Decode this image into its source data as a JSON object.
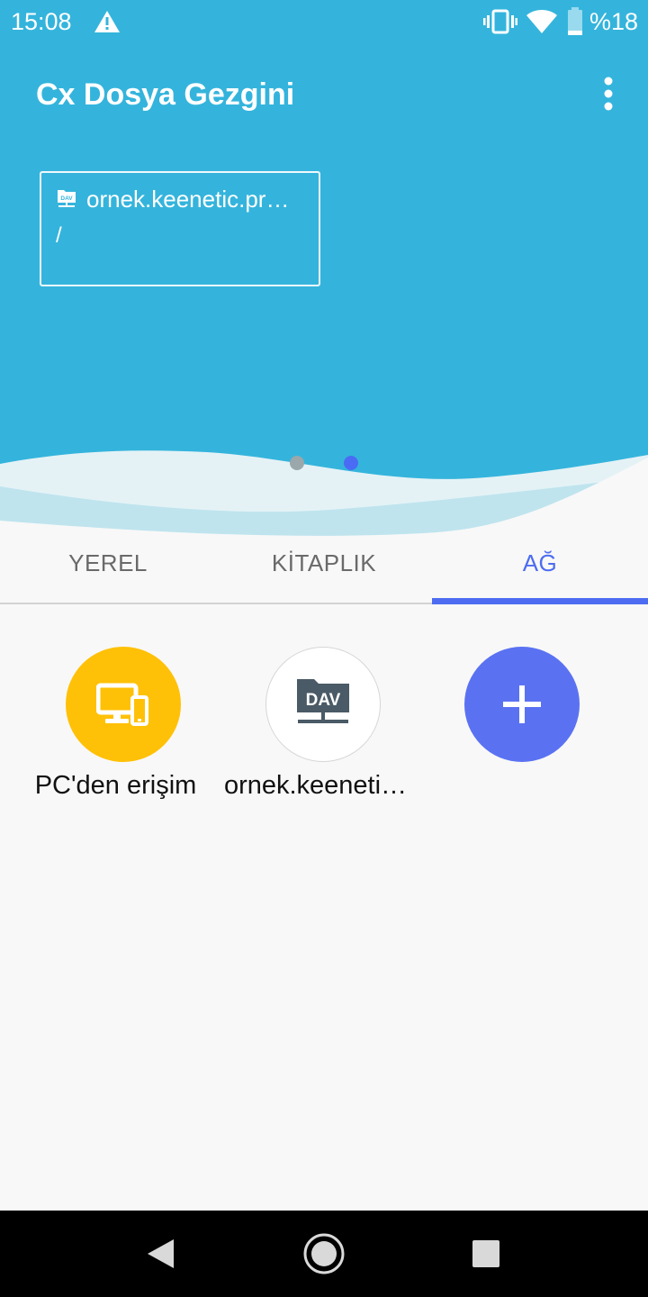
{
  "status_bar": {
    "time": "15:08",
    "battery": "%18",
    "icons": [
      "warning-icon",
      "vibrate-icon",
      "wifi-icon",
      "battery-icon"
    ]
  },
  "app_bar": {
    "title": "Cx Dosya Gezgini",
    "menu_icon": "more-vert-icon"
  },
  "recent_card": {
    "icon": "dav-icon",
    "icon_text": "DAV",
    "title": "ornek.keenetic.pr…",
    "path": "/"
  },
  "pager": {
    "page_count": 2,
    "active_index": 1
  },
  "tabs": [
    {
      "label": "YEREL",
      "selected": false
    },
    {
      "label": "KİTAPLIK",
      "selected": false
    },
    {
      "label": "AĞ",
      "selected": true
    }
  ],
  "network_items": [
    {
      "label": "PC'den erişim",
      "icon": "pc-devices-icon"
    },
    {
      "label": "ornek.keeneti…",
      "icon": "dav-folder-icon",
      "icon_text": "DAV"
    },
    {
      "label": "",
      "icon": "add-icon"
    }
  ],
  "nav_bar": {
    "icons": [
      "back-icon",
      "home-icon",
      "recents-icon"
    ]
  },
  "colors": {
    "header": "#34b4dc",
    "accent": "#4d6cf1",
    "pc_icon_bg": "#ffc107",
    "add_button_bg": "#5a72f2",
    "background": "#f8f8f8"
  }
}
